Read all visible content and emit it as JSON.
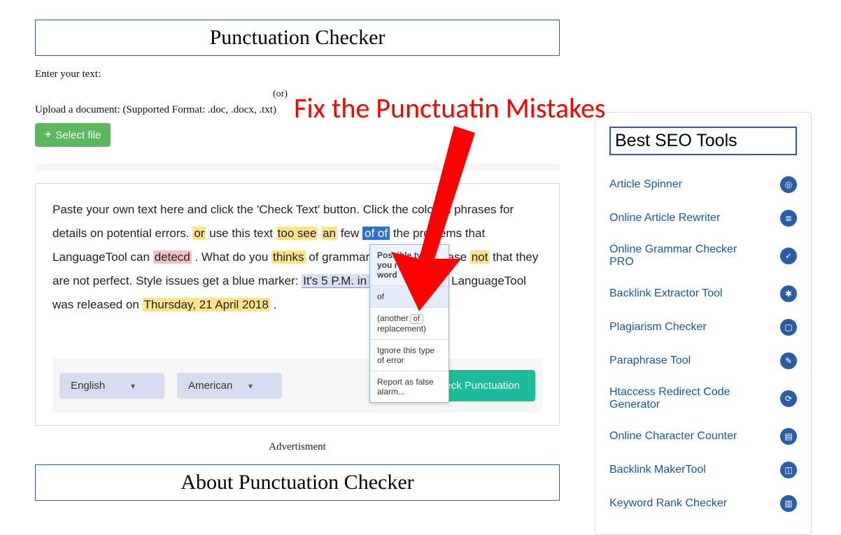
{
  "main": {
    "title": "Punctuation Checker",
    "enter_label": "Enter your text:",
    "or_label": "(or)",
    "upload_label": "Upload a document: (Supported Format: .doc, .docx, .txt)",
    "select_file": "Select file",
    "editor": {
      "pre1": "Paste your own text here and click the 'Check Text' button. Click the colored phrases for details on potential errors. ",
      "or": "or",
      "mid1": " use this text ",
      "toosee": "too see",
      "mid2": " ",
      "an": "an",
      "mid3": " few ",
      "ofof": "of of",
      "mid4": " the problems that LanguageTool can ",
      "detecd": "detecd",
      "mid5": ". What do you ",
      "thinks": "thinks",
      "mid6": " of grammar checkers? Please ",
      "not": "not",
      "mid7": " that they are not perfect. Style issues get a blue marker: ",
      "five": "It's 5 P.M. in the afternoon",
      "mid8": ". LanguageTool was released on ",
      "date": "Thursday, 21 April 2018",
      "end": "."
    },
    "lang": "English",
    "variant": "American",
    "check_btn": "Check Punctuation",
    "ad_label": "Advertisment",
    "about_title": "About Punctuation Checker"
  },
  "popover": {
    "head": "Possible typo: you repeated a word",
    "sugg": "of",
    "another1": "(another",
    "another_chip": "of",
    "another2": " replacement)",
    "ignore": "Ignore this type of error",
    "report": "Report as false alarm..."
  },
  "overlay_text": "Fix the Punctuatin Mistakes",
  "sidebar": {
    "title": "Best SEO Tools",
    "items": [
      "Article Spinner",
      "Online Article Rewriter",
      "Online Grammar Checker PRO",
      "Backlink Extractor Tool",
      "Plagiarism Checker",
      "Paraphrase Tool",
      "Htaccess Redirect Code Generator",
      "Online Character Counter",
      "Backlink MakerTool",
      "Keyword Rank Checker"
    ]
  }
}
